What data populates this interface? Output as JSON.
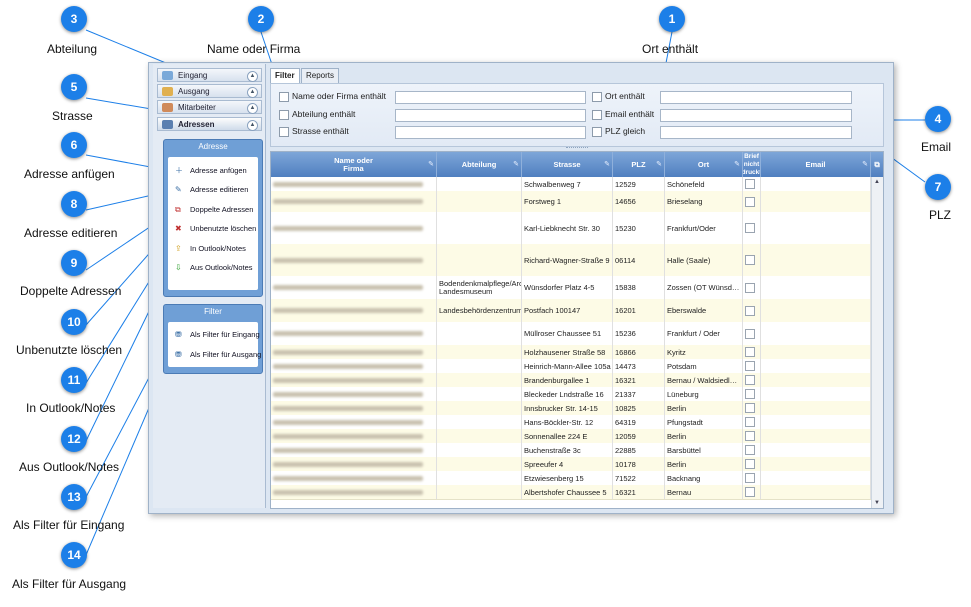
{
  "callouts": [
    {
      "num": "1",
      "label": "Ort enthält"
    },
    {
      "num": "2",
      "label": "Name oder Firma"
    },
    {
      "num": "3",
      "label": "Abteilung"
    },
    {
      "num": "4",
      "label": "Email"
    },
    {
      "num": "5",
      "label": "Strasse"
    },
    {
      "num": "6",
      "label": "Adresse anfügen"
    },
    {
      "num": "7",
      "label": "PLZ"
    },
    {
      "num": "8",
      "label": "Adresse editieren"
    },
    {
      "num": "9",
      "label": "Doppelte Adressen"
    },
    {
      "num": "10",
      "label": "Unbenutzte löschen"
    },
    {
      "num": "11",
      "label": "In Outlook/Notes"
    },
    {
      "num": "12",
      "label": "Aus Outlook/Notes"
    },
    {
      "num": "13",
      "label": "Als Filter für Eingang"
    },
    {
      "num": "14",
      "label": "Als Filter für Ausgang"
    }
  ],
  "nav": {
    "items": [
      "Eingang",
      "Ausgang",
      "Mitarbeiter",
      "Adressen"
    ],
    "active": "Adressen"
  },
  "adresse_panel": {
    "title": "Adresse",
    "buttons": [
      "Adresse anfügen",
      "Adresse editieren",
      "Doppelte Adressen",
      "Unbenutzte löschen",
      "In Outlook/Notes",
      "Aus Outlook/Notes"
    ]
  },
  "filter_panel": {
    "title": "Filter",
    "buttons": [
      "Als Filter für Eingang",
      "Als Filter für Ausgang"
    ]
  },
  "tabs": [
    "Filter",
    "Reports"
  ],
  "filter_fields": {
    "name_firma": "Name oder Firma enthält",
    "abteilung": "Abteilung enthält",
    "strasse": "Strasse enthält",
    "ort": "Ort enthält",
    "email": "Email enthält",
    "plz": "PLZ gleich"
  },
  "grid": {
    "headers": [
      "Name oder Firma",
      "Abteilung",
      "Strasse",
      "PLZ",
      "Ort",
      "Brief nicht druckt",
      "Email"
    ],
    "rows": [
      {
        "abteilung": "",
        "strasse": "Schwalbenweg 7",
        "plz": "12529",
        "ort": "Schönefeld"
      },
      {
        "abteilung": "",
        "strasse": "Forstweg 1",
        "plz": "14656",
        "ort": "Brieselang"
      },
      {
        "abteilung": "",
        "strasse": "Karl-Liebknecht Str. 30",
        "plz": "15230",
        "ort": "Frankfurt/Oder"
      },
      {
        "abteilung": "",
        "strasse": "Richard-Wagner-Straße 9",
        "plz": "06114",
        "ort": "Halle (Saale)"
      },
      {
        "abteilung": "Bodendenkmalpflege/Arc Landesmuseum",
        "strasse": "Wünsdorfer Platz 4-5",
        "plz": "15838",
        "ort": "Zossen (OT Wünsd…"
      },
      {
        "abteilung": "Landesbehördenzentrum",
        "strasse": "Postfach 100147",
        "plz": "16201",
        "ort": "Eberswalde"
      },
      {
        "abteilung": "",
        "strasse": "Müllroser Chaussee 51",
        "plz": "15236",
        "ort": "Frankfurt / Oder"
      },
      {
        "abteilung": "",
        "strasse": "Holzhausener Straße 58",
        "plz": "16866",
        "ort": "Kyritz"
      },
      {
        "abteilung": "",
        "strasse": "Heinrich-Mann-Allee 105a",
        "plz": "14473",
        "ort": "Potsdam"
      },
      {
        "abteilung": "",
        "strasse": "Brandenburgallee 1",
        "plz": "16321",
        "ort": "Bernau / Waldsiedl…"
      },
      {
        "abteilung": "",
        "strasse": "Bleckeder Lndstraße 16",
        "plz": "21337",
        "ort": "Lüneburg"
      },
      {
        "abteilung": "",
        "strasse": "Innsbrucker Str. 14-15",
        "plz": "10825",
        "ort": "Berlin"
      },
      {
        "abteilung": "",
        "strasse": "Hans-Böckler-Str. 12",
        "plz": "64319",
        "ort": "Pfungstadt"
      },
      {
        "abteilung": "",
        "strasse": "Sonnenallee 224 E",
        "plz": "12059",
        "ort": "Berlin"
      },
      {
        "abteilung": "",
        "strasse": "Buchenstraße 3c",
        "plz": "22885",
        "ort": "Barsbüttel"
      },
      {
        "abteilung": "",
        "strasse": "Spreeufer 4",
        "plz": "10178",
        "ort": "Berlin"
      },
      {
        "abteilung": "",
        "strasse": "Etzwiesenberg 15",
        "plz": "71522",
        "ort": "Backnang"
      },
      {
        "abteilung": "",
        "strasse": "Albertshofer Chaussee 5",
        "plz": "16321",
        "ort": "Bernau"
      }
    ]
  }
}
